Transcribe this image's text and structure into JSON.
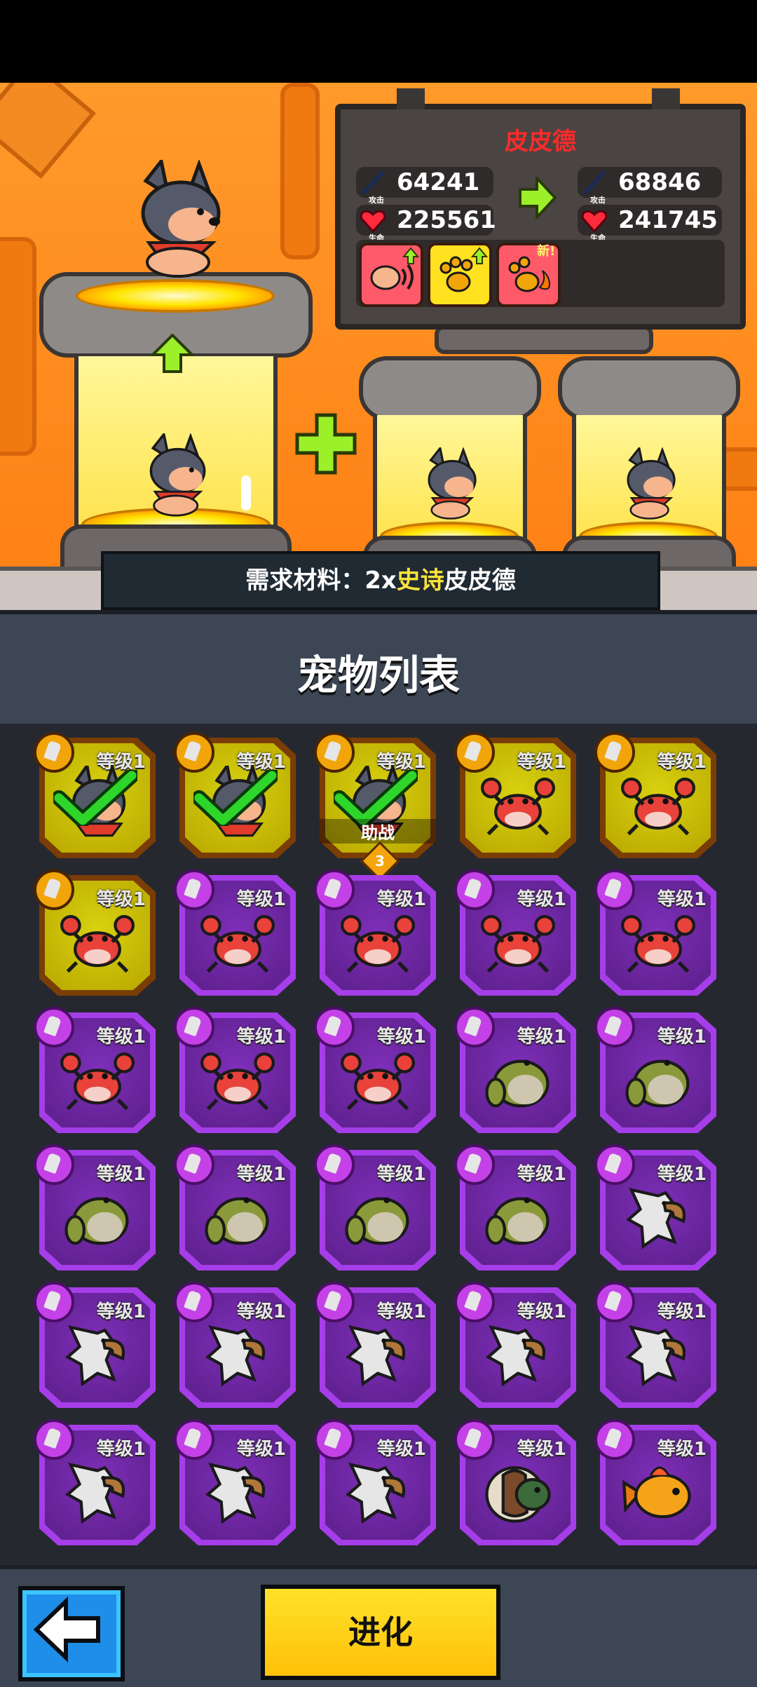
{
  "board": {
    "pet_name": "皮皮德",
    "attack_label": "攻击",
    "hp_label": "生命",
    "current_attack": "64241",
    "current_hp": "225561",
    "next_attack": "68846",
    "next_hp": "241745",
    "new_tag": "新!"
  },
  "material": {
    "prefix": "需求材料：2x",
    "rarity": "史诗",
    "name": "皮皮德"
  },
  "list": {
    "title": "宠物列表",
    "level_label": "等级1",
    "assist_label": "助战",
    "assist_slot": "3"
  },
  "pets": [
    {
      "kind": "dog",
      "rarity": "gold",
      "selected": true
    },
    {
      "kind": "dog",
      "rarity": "gold",
      "selected": true
    },
    {
      "kind": "dog",
      "rarity": "gold",
      "selected": true,
      "assist": true
    },
    {
      "kind": "crab",
      "rarity": "gold"
    },
    {
      "kind": "crab",
      "rarity": "gold"
    },
    {
      "kind": "crab",
      "rarity": "gold"
    },
    {
      "kind": "crab",
      "rarity": "purple"
    },
    {
      "kind": "crab",
      "rarity": "purple"
    },
    {
      "kind": "crab",
      "rarity": "purple"
    },
    {
      "kind": "crab",
      "rarity": "purple"
    },
    {
      "kind": "crab",
      "rarity": "purple"
    },
    {
      "kind": "crab",
      "rarity": "purple"
    },
    {
      "kind": "crab",
      "rarity": "purple"
    },
    {
      "kind": "frog",
      "rarity": "purple"
    },
    {
      "kind": "frog",
      "rarity": "purple"
    },
    {
      "kind": "frog",
      "rarity": "purple"
    },
    {
      "kind": "frog",
      "rarity": "purple"
    },
    {
      "kind": "frog",
      "rarity": "purple"
    },
    {
      "kind": "frog",
      "rarity": "purple"
    },
    {
      "kind": "eagle",
      "rarity": "purple"
    },
    {
      "kind": "eagle",
      "rarity": "purple"
    },
    {
      "kind": "eagle",
      "rarity": "purple"
    },
    {
      "kind": "eagle",
      "rarity": "purple"
    },
    {
      "kind": "eagle",
      "rarity": "purple"
    },
    {
      "kind": "eagle",
      "rarity": "purple"
    },
    {
      "kind": "eagle",
      "rarity": "purple"
    },
    {
      "kind": "eagle",
      "rarity": "purple"
    },
    {
      "kind": "eagle",
      "rarity": "purple"
    },
    {
      "kind": "turtle",
      "rarity": "purple"
    },
    {
      "kind": "goldfish",
      "rarity": "purple"
    }
  ],
  "buttons": {
    "evolve": "进化",
    "back_icon": "left-arrow-icon"
  },
  "colors": {
    "gold_card": "#c8be0c",
    "purple_card": "#6a24a0",
    "evolve_button": "#ffd21a",
    "back_button": "#1e8ee8",
    "name_red": "#ff2a2a",
    "rarity_yellow": "#ffe23a"
  }
}
